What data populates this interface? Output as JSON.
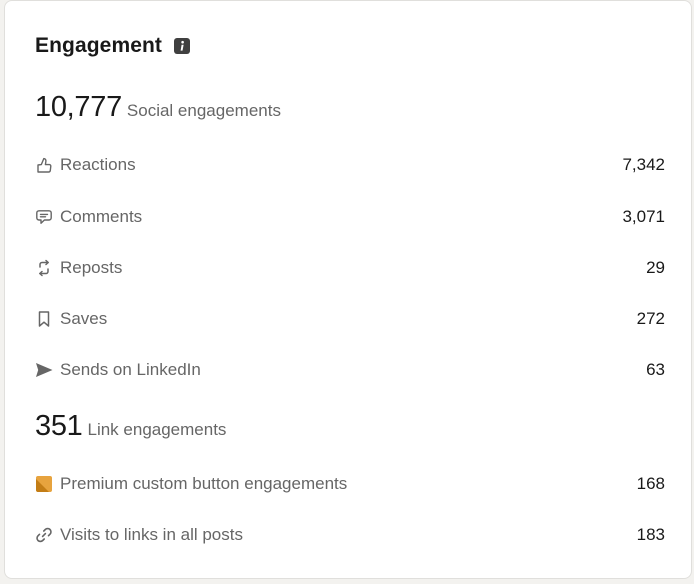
{
  "card": {
    "title": "Engagement",
    "info_icon": "info-icon"
  },
  "social": {
    "total": "10,777",
    "label": "Social engagements",
    "items": [
      {
        "icon": "thumbs-up-icon",
        "label": "Reactions",
        "value": "7,342"
      },
      {
        "icon": "comment-icon",
        "label": "Comments",
        "value": "3,071"
      },
      {
        "icon": "repost-icon",
        "label": "Reposts",
        "value": "29"
      },
      {
        "icon": "bookmark-icon",
        "label": "Saves",
        "value": "272"
      },
      {
        "icon": "send-icon",
        "label": "Sends on LinkedIn",
        "value": "63"
      }
    ]
  },
  "link": {
    "total": "351",
    "label": "Link engagements",
    "items": [
      {
        "icon": "premium-icon",
        "label": "Premium custom button engagements",
        "value": "168"
      },
      {
        "icon": "link-icon",
        "label": "Visits to links in all posts",
        "value": "183"
      }
    ]
  },
  "colors": {
    "text_primary": "#191919",
    "text_secondary": "#666666",
    "icon": "#666666",
    "premium_gold": "#e7a33e",
    "premium_dark": "#c37d16"
  }
}
